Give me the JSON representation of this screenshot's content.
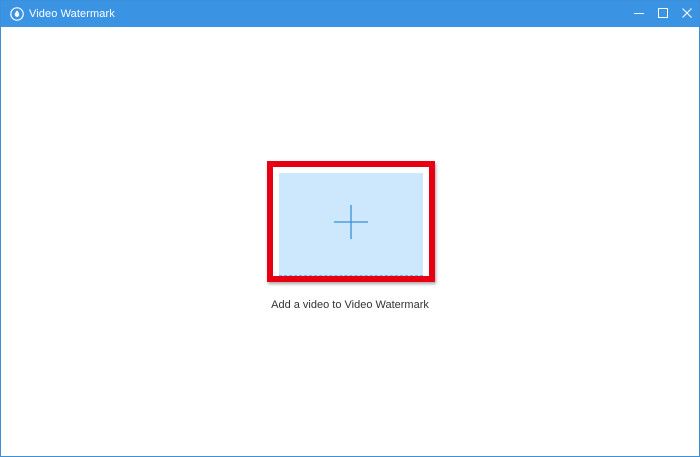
{
  "window": {
    "title": "Video Watermark",
    "title_bar_color": "#3b93e3"
  },
  "controls": {
    "minimize_icon": "minimize-icon",
    "maximize_icon": "maximize-icon",
    "close_icon": "close-icon"
  },
  "main": {
    "add_icon": "plus-icon",
    "caption": "Add a video to Video Watermark",
    "highlight_color": "#e60012",
    "drop_zone_color": "#cde8fd"
  }
}
